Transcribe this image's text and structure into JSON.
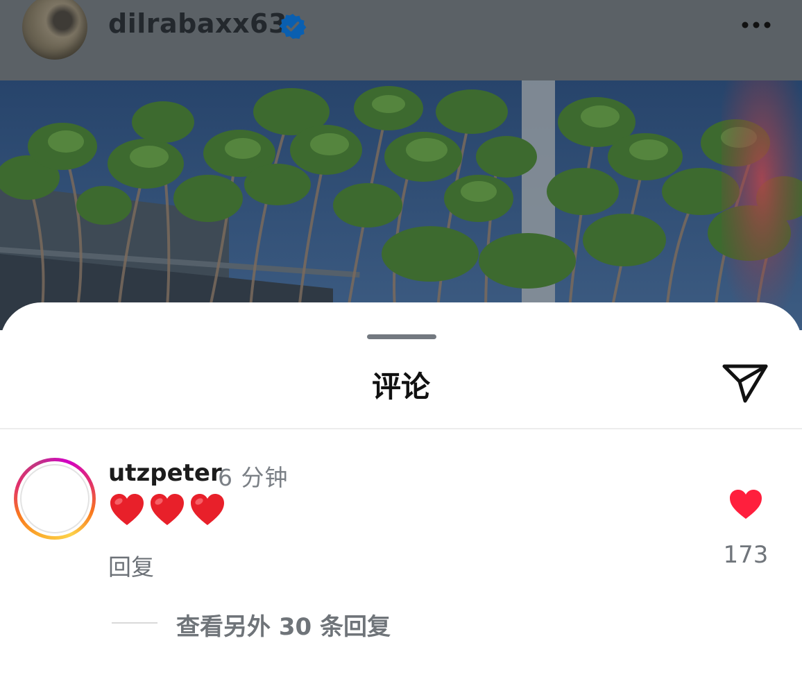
{
  "post": {
    "username": "dilrabaxx63",
    "verified": true,
    "icons": {
      "avatar": "profile-avatar",
      "verified": "verified-badge-icon",
      "more": "more-options-icon"
    }
  },
  "sheet": {
    "title": "评论",
    "icons": {
      "share": "send-paper-plane-icon"
    }
  },
  "comments": [
    {
      "username": "utzpeter",
      "time": "6 分钟",
      "text": "❤️❤️❤️",
      "reply_label": "回复",
      "like_count": "173",
      "liked": true,
      "view_replies_label": "查看另外 30 条回复"
    }
  ],
  "colors": {
    "like": "#ff1f3d",
    "verified": "#0a6fd6",
    "avatar_ring_start": "#fbb130",
    "avatar_ring_end": "#d300c5"
  }
}
